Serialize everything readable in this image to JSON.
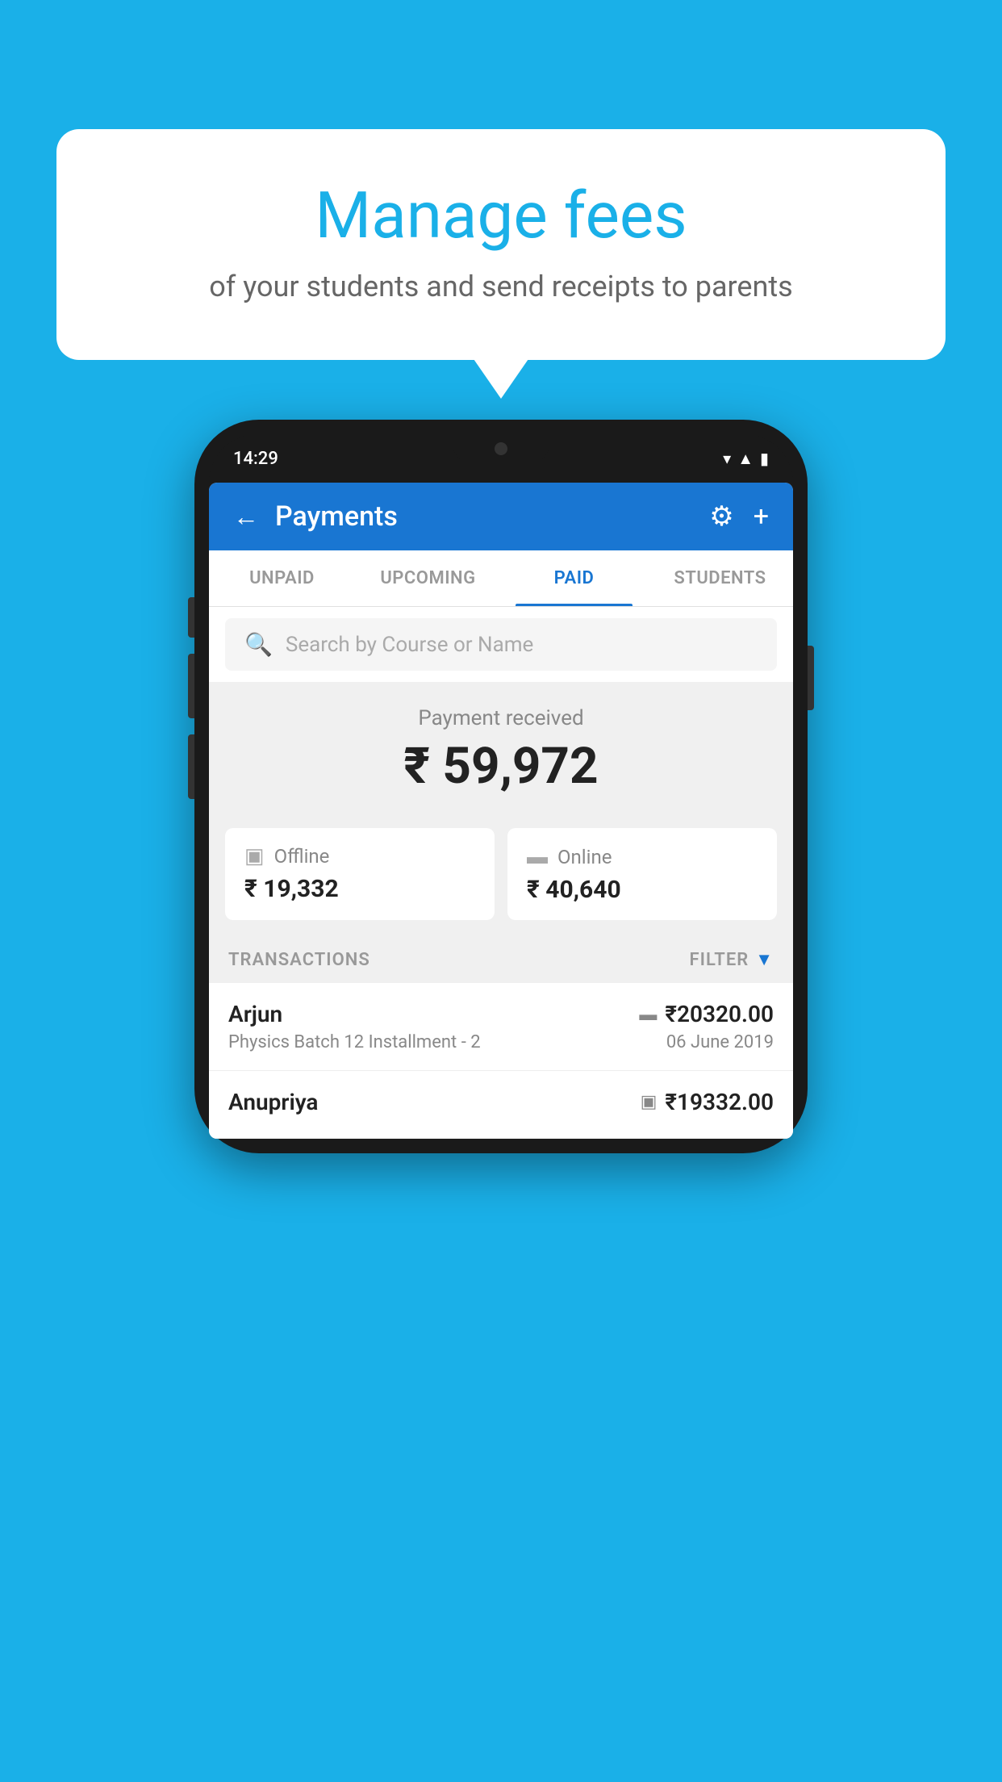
{
  "background": {
    "color": "#1ab0e8"
  },
  "speech_bubble": {
    "title": "Manage fees",
    "subtitle": "of your students and send receipts to parents"
  },
  "phone": {
    "status_bar": {
      "time": "14:29",
      "icons": [
        "wifi",
        "signal",
        "battery"
      ]
    },
    "app_header": {
      "title": "Payments",
      "back_label": "←",
      "settings_icon": "⚙",
      "add_icon": "+"
    },
    "tabs": [
      {
        "label": "UNPAID",
        "active": false
      },
      {
        "label": "UPCOMING",
        "active": false
      },
      {
        "label": "PAID",
        "active": true
      },
      {
        "label": "STUDENTS",
        "active": false
      }
    ],
    "search": {
      "placeholder": "Search by Course or Name"
    },
    "payment_received": {
      "label": "Payment received",
      "total": "₹ 59,972",
      "offline": {
        "label": "Offline",
        "amount": "₹ 19,332"
      },
      "online": {
        "label": "Online",
        "amount": "₹ 40,640"
      }
    },
    "transactions": {
      "section_label": "TRANSACTIONS",
      "filter_label": "FILTER",
      "rows": [
        {
          "name": "Arjun",
          "description": "Physics Batch 12 Installment - 2",
          "amount": "₹20320.00",
          "date": "06 June 2019",
          "type": "online"
        },
        {
          "name": "Anupriya",
          "description": "",
          "amount": "₹19332.00",
          "date": "",
          "type": "offline"
        }
      ]
    }
  }
}
